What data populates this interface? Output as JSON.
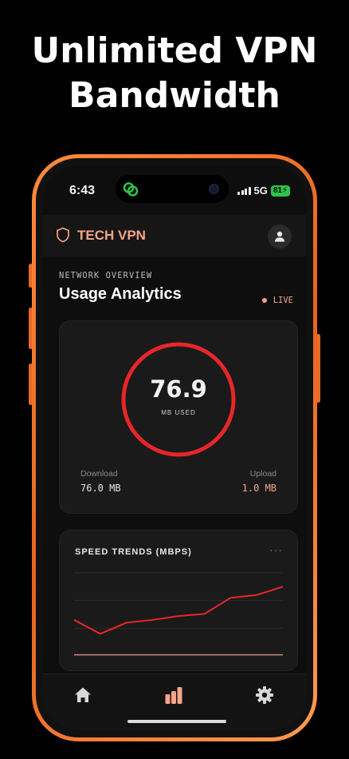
{
  "promo": {
    "headline_line1": "Unlimited VPN",
    "headline_line2": "Bandwidth"
  },
  "status_bar": {
    "time": "6:43",
    "network": "5G",
    "battery": "81"
  },
  "app_bar": {
    "brand": "TECH VPN",
    "brand_icon": "shield-icon",
    "profile_icon": "user-icon"
  },
  "header": {
    "overline": "NETWORK OVERVIEW",
    "title": "Usage Analytics",
    "live_label": "LIVE"
  },
  "usage": {
    "total": "76.9",
    "unit_label": "MB USED",
    "download_label": "Download",
    "download_value": "76.0 MB",
    "upload_label": "Upload",
    "upload_value": "1.0 MB"
  },
  "speed_trends": {
    "title": "SPEED TRENDS (MBPS)",
    "menu_label": "···"
  },
  "nav": {
    "items": [
      "home-icon",
      "bar-chart-icon",
      "gear-icon"
    ],
    "active": "bar-chart-icon"
  },
  "colors": {
    "accent": "#f6a48a",
    "ring": "#e8262a",
    "frame": "#e8621c",
    "download_line": "#e8262a",
    "upload_line": "#c98a78"
  },
  "chart_data": {
    "type": "line",
    "title": "SPEED TRENDS (MBPS)",
    "xlabel": "",
    "ylabel": "",
    "grid": true,
    "x": [
      1,
      2,
      3,
      4,
      5,
      6,
      7,
      8,
      9
    ],
    "series": [
      {
        "values": [
          0.65,
          0.4,
          0.6,
          0.65,
          0.72,
          0.76,
          1.05,
          1.1,
          1.25
        ]
      },
      {
        "values": [
          0.02,
          0.02,
          0.02,
          0.02,
          0.02,
          0.02,
          0.02,
          0.02,
          0.02
        ]
      }
    ],
    "ylim": [
      0,
      1.5
    ]
  }
}
